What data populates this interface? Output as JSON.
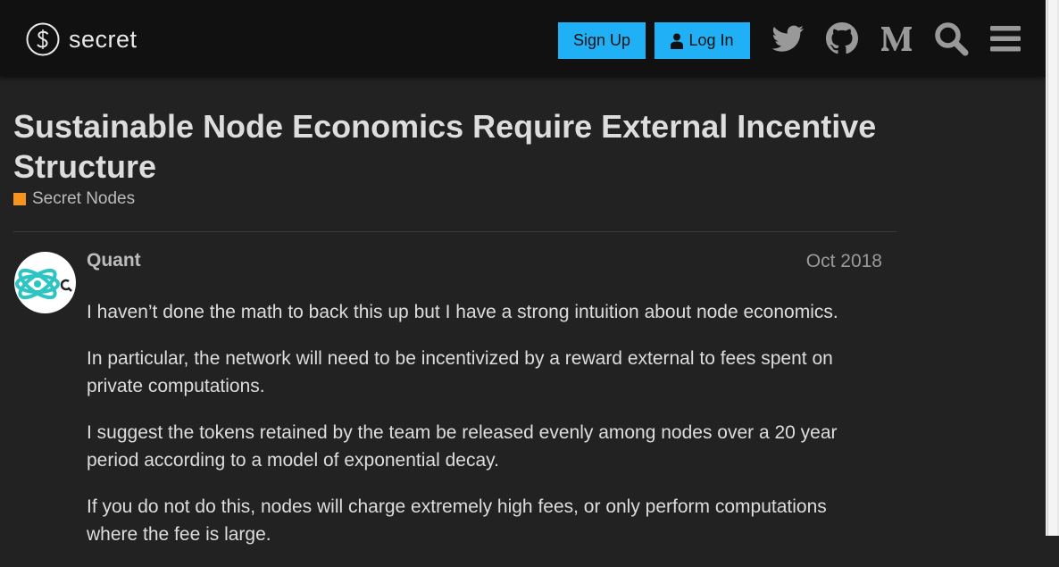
{
  "header": {
    "logo_text": "secret",
    "signup_label": "Sign Up",
    "login_label": "Log In",
    "icons": [
      "twitter-icon",
      "github-icon",
      "medium-icon",
      "search-icon",
      "menu-icon"
    ],
    "accent_color": "#1fb0f6"
  },
  "topic": {
    "title": "Sustainable Node Economics Require External Incentive Structure",
    "category": "Secret Nodes",
    "category_color": "#f7941d"
  },
  "post": {
    "author": "Quant",
    "date": "Oct 2018",
    "paragraphs": [
      "I haven’t done the math to back this up but I have a strong intuition about node economics.",
      "In particular, the network will need to be incentivized by a reward external to fees spent on private computations.",
      "I suggest the tokens retained by the team be released evenly among nodes over a 20 year period according to a model of exponential decay.",
      "If you do not do this, nodes will charge extremely high fees, or only perform computations where the fee is large."
    ]
  }
}
